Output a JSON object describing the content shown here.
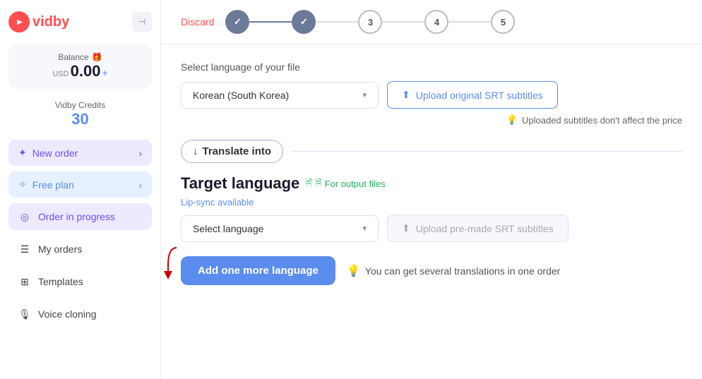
{
  "logo": {
    "text": "vidby"
  },
  "sidebar": {
    "balance_label": "Balance",
    "balance_currency": "USD",
    "balance_amount": "0.00",
    "balance_plus": "+",
    "credits_label": "Vidby Credits",
    "credits_amount": "30",
    "new_order_label": "New order",
    "free_plan_label": "Free plan",
    "nav_items": [
      {
        "label": "Order in progress",
        "icon": "⟳",
        "active": true
      },
      {
        "label": "My orders",
        "icon": "☰",
        "active": false
      },
      {
        "label": "Templates",
        "icon": "⊞",
        "active": false
      },
      {
        "label": "Voice cloning",
        "icon": "🎙",
        "active": false
      }
    ]
  },
  "topbar": {
    "discard_label": "Discard",
    "steps": [
      {
        "number": "✓",
        "completed": true
      },
      {
        "number": "✓",
        "completed": true
      },
      {
        "number": "3",
        "current": true
      },
      {
        "number": "4",
        "current": false
      },
      {
        "number": "5",
        "current": false
      }
    ]
  },
  "content": {
    "file_language_label": "Select language of your file",
    "file_language_value": "Korean (South Korea)",
    "upload_srt_label": "Upload original SRT subtitles",
    "upload_note": "Uploaded subtitles don't affect the price",
    "translate_into_label": "Translate into",
    "target_language_title": "Target language",
    "output_files_label": "For output files",
    "lip_sync_label": "Lip-sync available",
    "select_language_placeholder": "Select language",
    "upload_premade_label": "Upload pre-made SRT subtitles",
    "add_language_label": "Add one more language",
    "several_translations_note": "You can get several translations in one order"
  }
}
